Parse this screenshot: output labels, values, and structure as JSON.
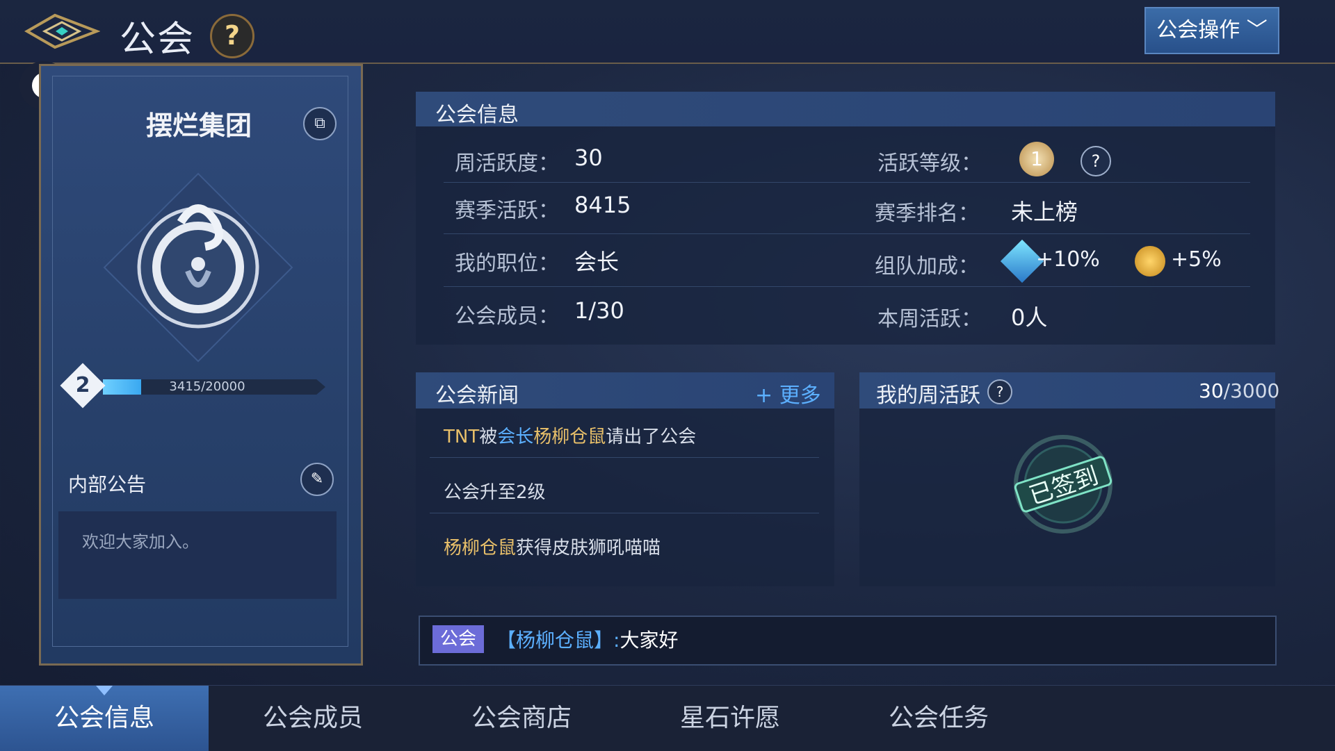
{
  "header": {
    "title": "公会",
    "help": "?",
    "ops_label": "公会操作",
    "ops_chevron": "﹀"
  },
  "guild": {
    "name": "摆烂集团",
    "level": "2",
    "progress_text": "3415/20000",
    "progress_fraction": 0.17075,
    "notice_label": "内部公告",
    "notice_text": "欢迎大家加入。"
  },
  "info": {
    "title": "公会信息",
    "weekly_active_label": "周活跃度：",
    "weekly_active_value": "30",
    "active_level_label": "活跃等级：",
    "active_level_value": "1",
    "season_active_label": "赛季活跃：",
    "season_active_value": "8415",
    "season_rank_label": "赛季排名：",
    "season_rank_value": "未上榜",
    "position_label": "我的职位：",
    "position_value": "会长",
    "team_bonus_label": "组队加成：",
    "bonus1": "+10%",
    "bonus2": "+5%",
    "members_label": "公会成员：",
    "members_value": "1/30",
    "week_active_label": "本周活跃：",
    "week_active_value": "0人"
  },
  "news": {
    "title": "公会新闻",
    "more_label": "更多",
    "item1_a": "TNT",
    "item1_b": "被",
    "item1_c": "会长",
    "item1_d": "杨柳仓鼠",
    "item1_e": "请出了公会",
    "item2": "公会升至2级",
    "item3_a": "杨柳仓鼠",
    "item3_b": "获得皮肤狮吼喵喵"
  },
  "weekly": {
    "title": "我的周活跃",
    "current": "30",
    "total": "/3000",
    "stamp": "已签到"
  },
  "chat": {
    "channel": "公会",
    "name": "【杨柳仓鼠】",
    "colon": ":",
    "message": "大家好"
  },
  "tabs": [
    "公会信息",
    "公会成员",
    "公会商店",
    "星石许愿",
    "公会任务"
  ],
  "colors": {
    "accent_blue": "#5cb0ff",
    "gold": "#e9c06a",
    "tab_active": "#3e6fb2"
  },
  "icons": [
    "back-icon",
    "help-icon",
    "chevron-down-icon",
    "copy-icon",
    "dragon-emblem-icon",
    "edit-icon",
    "medal-icon",
    "blue-gem-icon",
    "gold-coin-icon",
    "plus-icon",
    "checked-in-stamp-icon"
  ]
}
